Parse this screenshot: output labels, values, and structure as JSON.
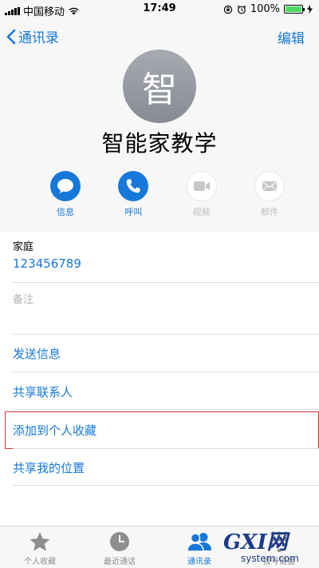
{
  "status_bar": {
    "carrier": "中国移动",
    "time": "17:49",
    "battery": "100%"
  },
  "nav": {
    "back_label": "通讯录",
    "edit_label": "编辑"
  },
  "contact": {
    "avatar_initial": "智",
    "name": "智能家教学"
  },
  "actions": [
    {
      "label": "信息",
      "icon": "message-icon",
      "enabled": true
    },
    {
      "label": "呼叫",
      "icon": "phone-icon",
      "enabled": true
    },
    {
      "label": "视频",
      "icon": "video-icon",
      "enabled": false
    },
    {
      "label": "邮件",
      "icon": "mail-icon",
      "enabled": false
    }
  ],
  "phone": {
    "label": "家庭",
    "number": "123456789"
  },
  "notes": {
    "label": "备注"
  },
  "links": [
    "发送信息",
    "共享联系人",
    "添加到个人收藏",
    "共享我的位置"
  ],
  "tabs": [
    {
      "label": "个人收藏",
      "icon": "star-icon",
      "active": false
    },
    {
      "label": "最近通话",
      "icon": "clock-icon",
      "active": false
    },
    {
      "label": "通讯录",
      "icon": "contacts-icon",
      "active": true
    },
    {
      "label": "拨号键盘",
      "icon": "keypad-icon",
      "active": false
    }
  ],
  "watermark": {
    "text_top": "GXI网",
    "text_bottom": "system.com"
  },
  "colors": {
    "accent": "#1678d9",
    "highlight_border": "#d0393a",
    "battery_green": "#4cd964"
  }
}
